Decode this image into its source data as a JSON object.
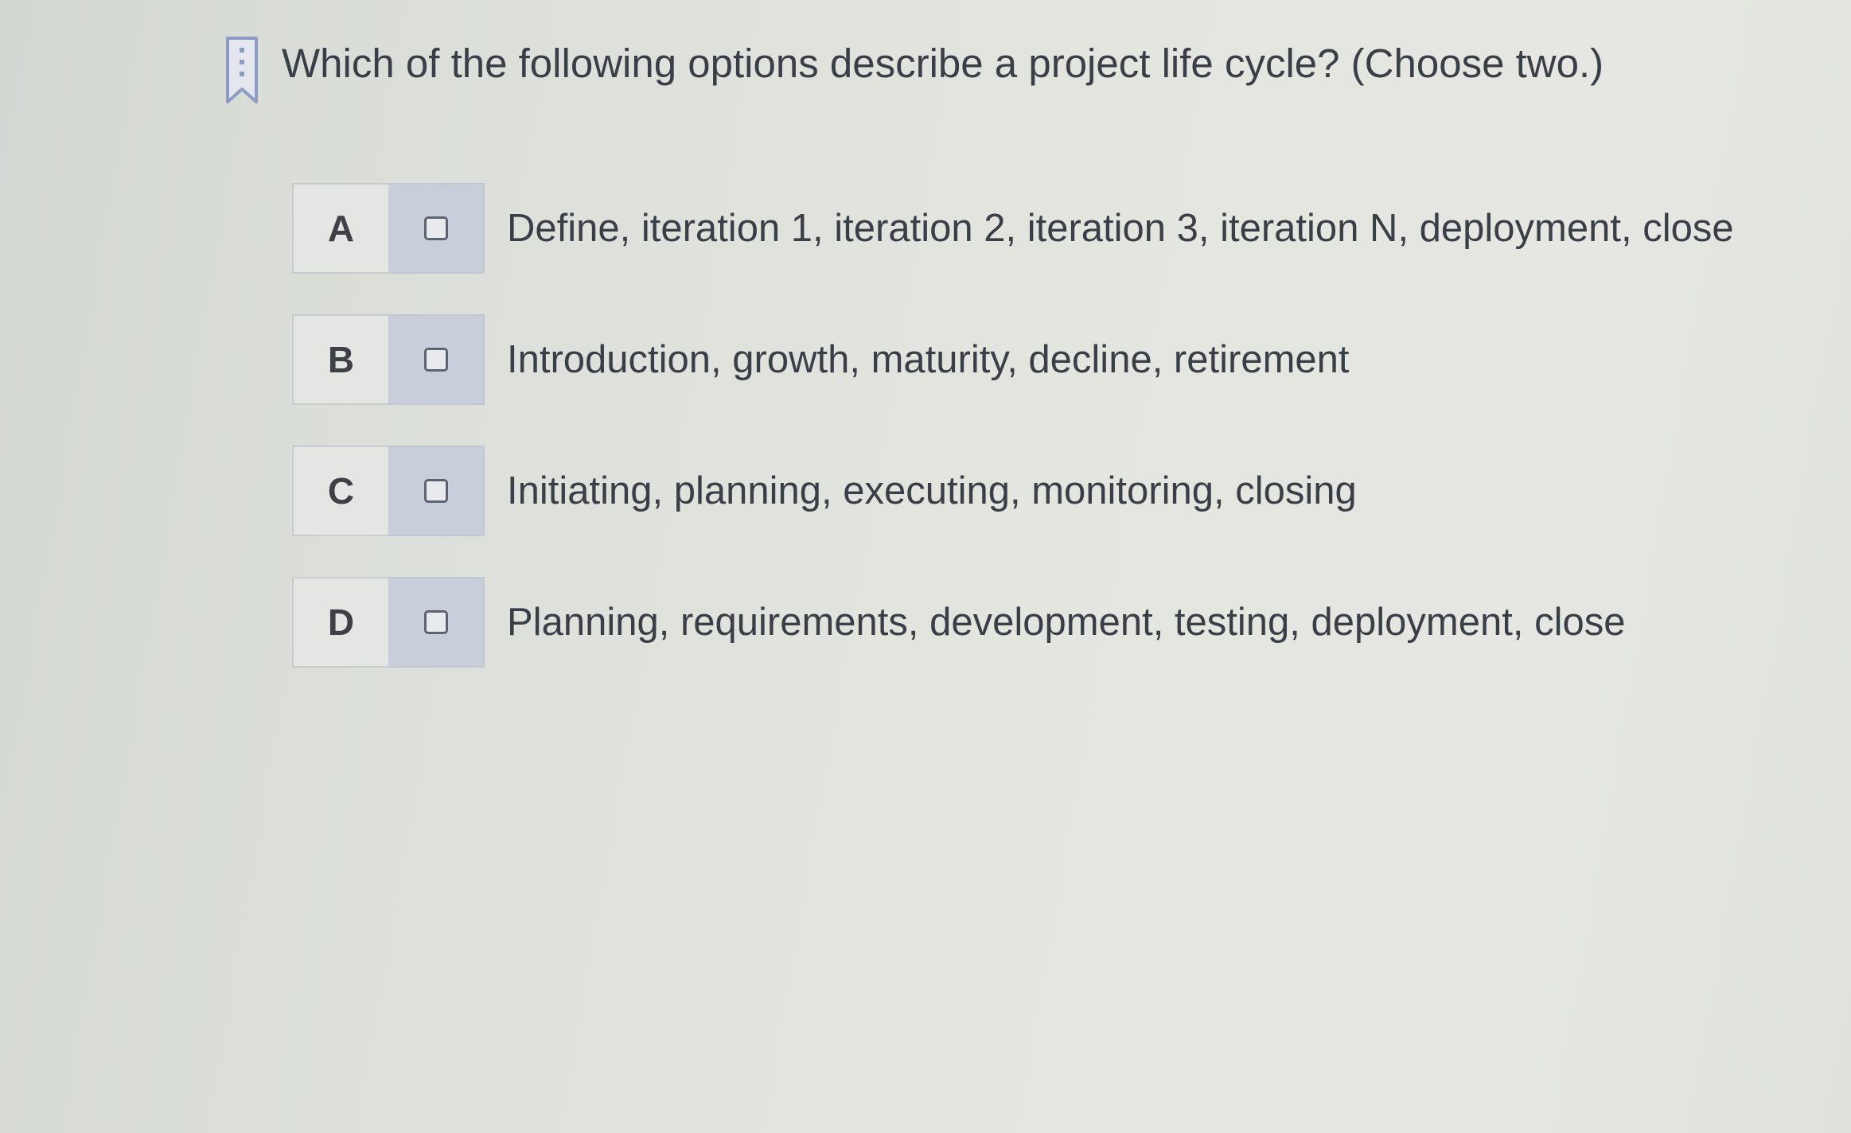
{
  "question": {
    "text": "Which of the following options describe a project life cycle? (Choose two.)",
    "bookmark_icon": "bookmark-icon"
  },
  "options": [
    {
      "letter": "A",
      "text": "Define, iteration 1, iteration 2, iteration 3, iteration N, deployment, close",
      "checked": false
    },
    {
      "letter": "B",
      "text": "Introduction, growth, maturity, decline, retirement",
      "checked": false
    },
    {
      "letter": "C",
      "text": "Initiating, planning, executing, monitoring, closing",
      "checked": false
    },
    {
      "letter": "D",
      "text": "Planning, requirements, development, testing, deployment, close",
      "checked": false
    }
  ],
  "colors": {
    "text": "#3a3e46",
    "checkbox_cell": "#c9cfda",
    "bookmark": "#8c9cc4"
  }
}
